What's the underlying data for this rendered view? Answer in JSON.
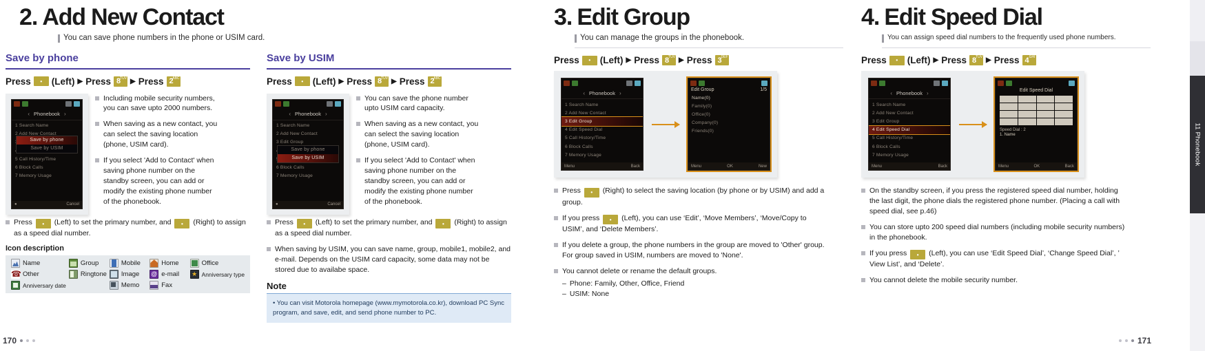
{
  "tab_strip": {
    "label": "11 Phonebook"
  },
  "folio": {
    "left": "170",
    "right": "171"
  },
  "sections": [
    {
      "num": "2.",
      "title": "Add New Contact",
      "subtitle": "You can save phone numbers in the phone or USIM card.",
      "sub_sections": [
        {
          "name": "Save by phone",
          "press": {
            "pre": "Press",
            "nav_label": "(Left)",
            "mid": "Press",
            "key1": "8",
            "key1_sup": "TUV",
            "mid2": "Press",
            "key2": "2",
            "key2_sup": "ABC"
          },
          "bullets": [
            "Including mobile security numbers, you can save upto 2000 numbers.",
            "When saving as a new contact, you can select the saving location (phone, USIM card).",
            "If you select 'Add to Contact' when saving phone number on the standby screen, you can add or modify the existing phone number of the phonebook."
          ],
          "footnote": {
            "a": "Press",
            "a2": "(Left) to set the primary number, and",
            "a3": "(Right) to assign as a speed dial number."
          }
        },
        {
          "name": "Save by USIM",
          "press": {
            "pre": "Press",
            "nav_label": "(Left)",
            "mid": "Press",
            "key1": "8",
            "key1_sup": "TUV",
            "mid2": "Press",
            "key2": "2",
            "key2_sup": "ABC"
          },
          "bullets": [
            "You can save the phone number upto USIM card capacity.",
            "When saving as a new contact, you can select the saving location (phone, USIM card).",
            "If you select 'Add to Contact' when saving phone number on the standby screen, you can add or modify the existing phone number of the phonebook."
          ],
          "footnote": {
            "a": "Press",
            "a2": "(Left) to set the primary number, and",
            "a3": "(Right) to assign as a speed dial number."
          },
          "extra_bullet": "When saving by USIM, you can save name, group, mobile1, mobile2, and e-mail. Depends on the USIM card capacity, some data may not be stored due to availabe space."
        }
      ]
    },
    {
      "num": "3.",
      "title": "Edit Group",
      "subtitle": "You can manage the groups in the phonebook.",
      "press": {
        "pre": "Press",
        "nav_label": "(Left)",
        "mid": "Press",
        "key1": "8",
        "key1_sup": "TUV",
        "mid2": "Press",
        "key2": "3",
        "key2_sup": "DEF"
      },
      "bullets": [
        "Press |KEY| (Right) to select the saving location (by phone or by USIM) and add a group.",
        "If you press |KEY| (Left), you can use 'Edit', 'Move Members', 'Move/Copy to USIM', and 'Delete Members'.",
        "If you delete a group, the phone numbers in the group are moved to 'Other' group. For group saved in USIM, numbers are moved to 'None'.",
        "You cannot delete or rename the default groups."
      ],
      "dashes": [
        "Phone: Family, Other, Office, Friend",
        "USIM: None"
      ]
    },
    {
      "num": "4.",
      "title": "Edit Speed Dial",
      "subtitle": "You can assign speed dial numbers to the frequently used phone numbers.",
      "press": {
        "pre": "Press",
        "nav_label": "(Left)",
        "mid": "Press",
        "key1": "8",
        "key1_sup": "TUV",
        "mid2": "Press",
        "key2": "4",
        "key2_sup": "GHI"
      },
      "bullets": [
        "On the standby screen, if you press the registered speed dial number, holding the last digit, the phone dials the registered phone number. (Placing a call with speed dial, see p.46)",
        "You can store upto 200 speed dial numbers (including mobile security numbers) in the phonebook.",
        "If you press |KEY| (Left), you can use 'Edit Speed Dial', 'Change Speed Dial', ' View List', and 'Delete'.",
        "You cannot delete the mobile security number."
      ]
    }
  ],
  "icon_description": {
    "title": "Icon description",
    "items": [
      {
        "icon": "name-icon",
        "label": "Name"
      },
      {
        "icon": "group-folder-icon",
        "label": "Group"
      },
      {
        "icon": "mobile-phone-icon",
        "label": "Mobile"
      },
      {
        "icon": "home-icon",
        "label": "Home"
      },
      {
        "icon": "office-building-icon",
        "label": "Office"
      },
      {
        "icon": "other-handset-icon",
        "label": "Other"
      },
      {
        "icon": "ringtone-speaker-icon",
        "label": "Ringtone"
      },
      {
        "icon": "image-picture-icon",
        "label": "Image"
      },
      {
        "icon": "email-at-icon",
        "label": "e-mail"
      },
      {
        "icon": "anniversary-type-icon",
        "label": "Anniversary type"
      },
      {
        "icon": "anniversary-date-icon",
        "label": "Anniversary date"
      },
      {
        "icon": "",
        "label": ""
      },
      {
        "icon": "memo-icon",
        "label": "Memo"
      },
      {
        "icon": "fax-icon",
        "label": "Fax"
      },
      {
        "icon": "",
        "label": ""
      }
    ]
  },
  "note": {
    "title": "Note",
    "body": "• You can visit Motorola homepage (www.mymotorola.co.kr), download PC Sync program, and save, edit, and send phone number to PC."
  },
  "phone_screens": {
    "phonebook_menu": {
      "title": "Phonebook",
      "rows": [
        "1  Search Name",
        "2  Add New Contact",
        "3  Edit Group",
        "4  Edit Speed Dial",
        "5  Call History/Time",
        "6  Block Calls",
        "7  Memory Usage"
      ],
      "soft_left": "Menu",
      "soft_right": "Back"
    },
    "save_popup": {
      "rows": [
        "Save by phone",
        "Save by USIM"
      ],
      "soft_right": "Cancel"
    },
    "edit_group": {
      "title": "Edit Group",
      "count": "1/5",
      "rows": [
        "Name(0)",
        "Family(0)",
        "Office(0)",
        "Company(0)",
        "Friends(0)"
      ],
      "soft_left": "Menu",
      "soft_mid": "OK",
      "soft_right": "New"
    },
    "edit_speed_dial": {
      "title": "Edit Speed Dial",
      "footer": "Speed Dial : 2",
      "footer2": "1. Name",
      "soft_left": "Menu",
      "soft_mid": "OK",
      "soft_right": "Back"
    }
  },
  "colors": {
    "accent_purple": "#4a3f9e",
    "keycap_gold": "#b9a83a",
    "highlight_orange": "#d9901a",
    "note_blue": "#dfeaf6",
    "icon_table_bg": "#e6eaed"
  }
}
